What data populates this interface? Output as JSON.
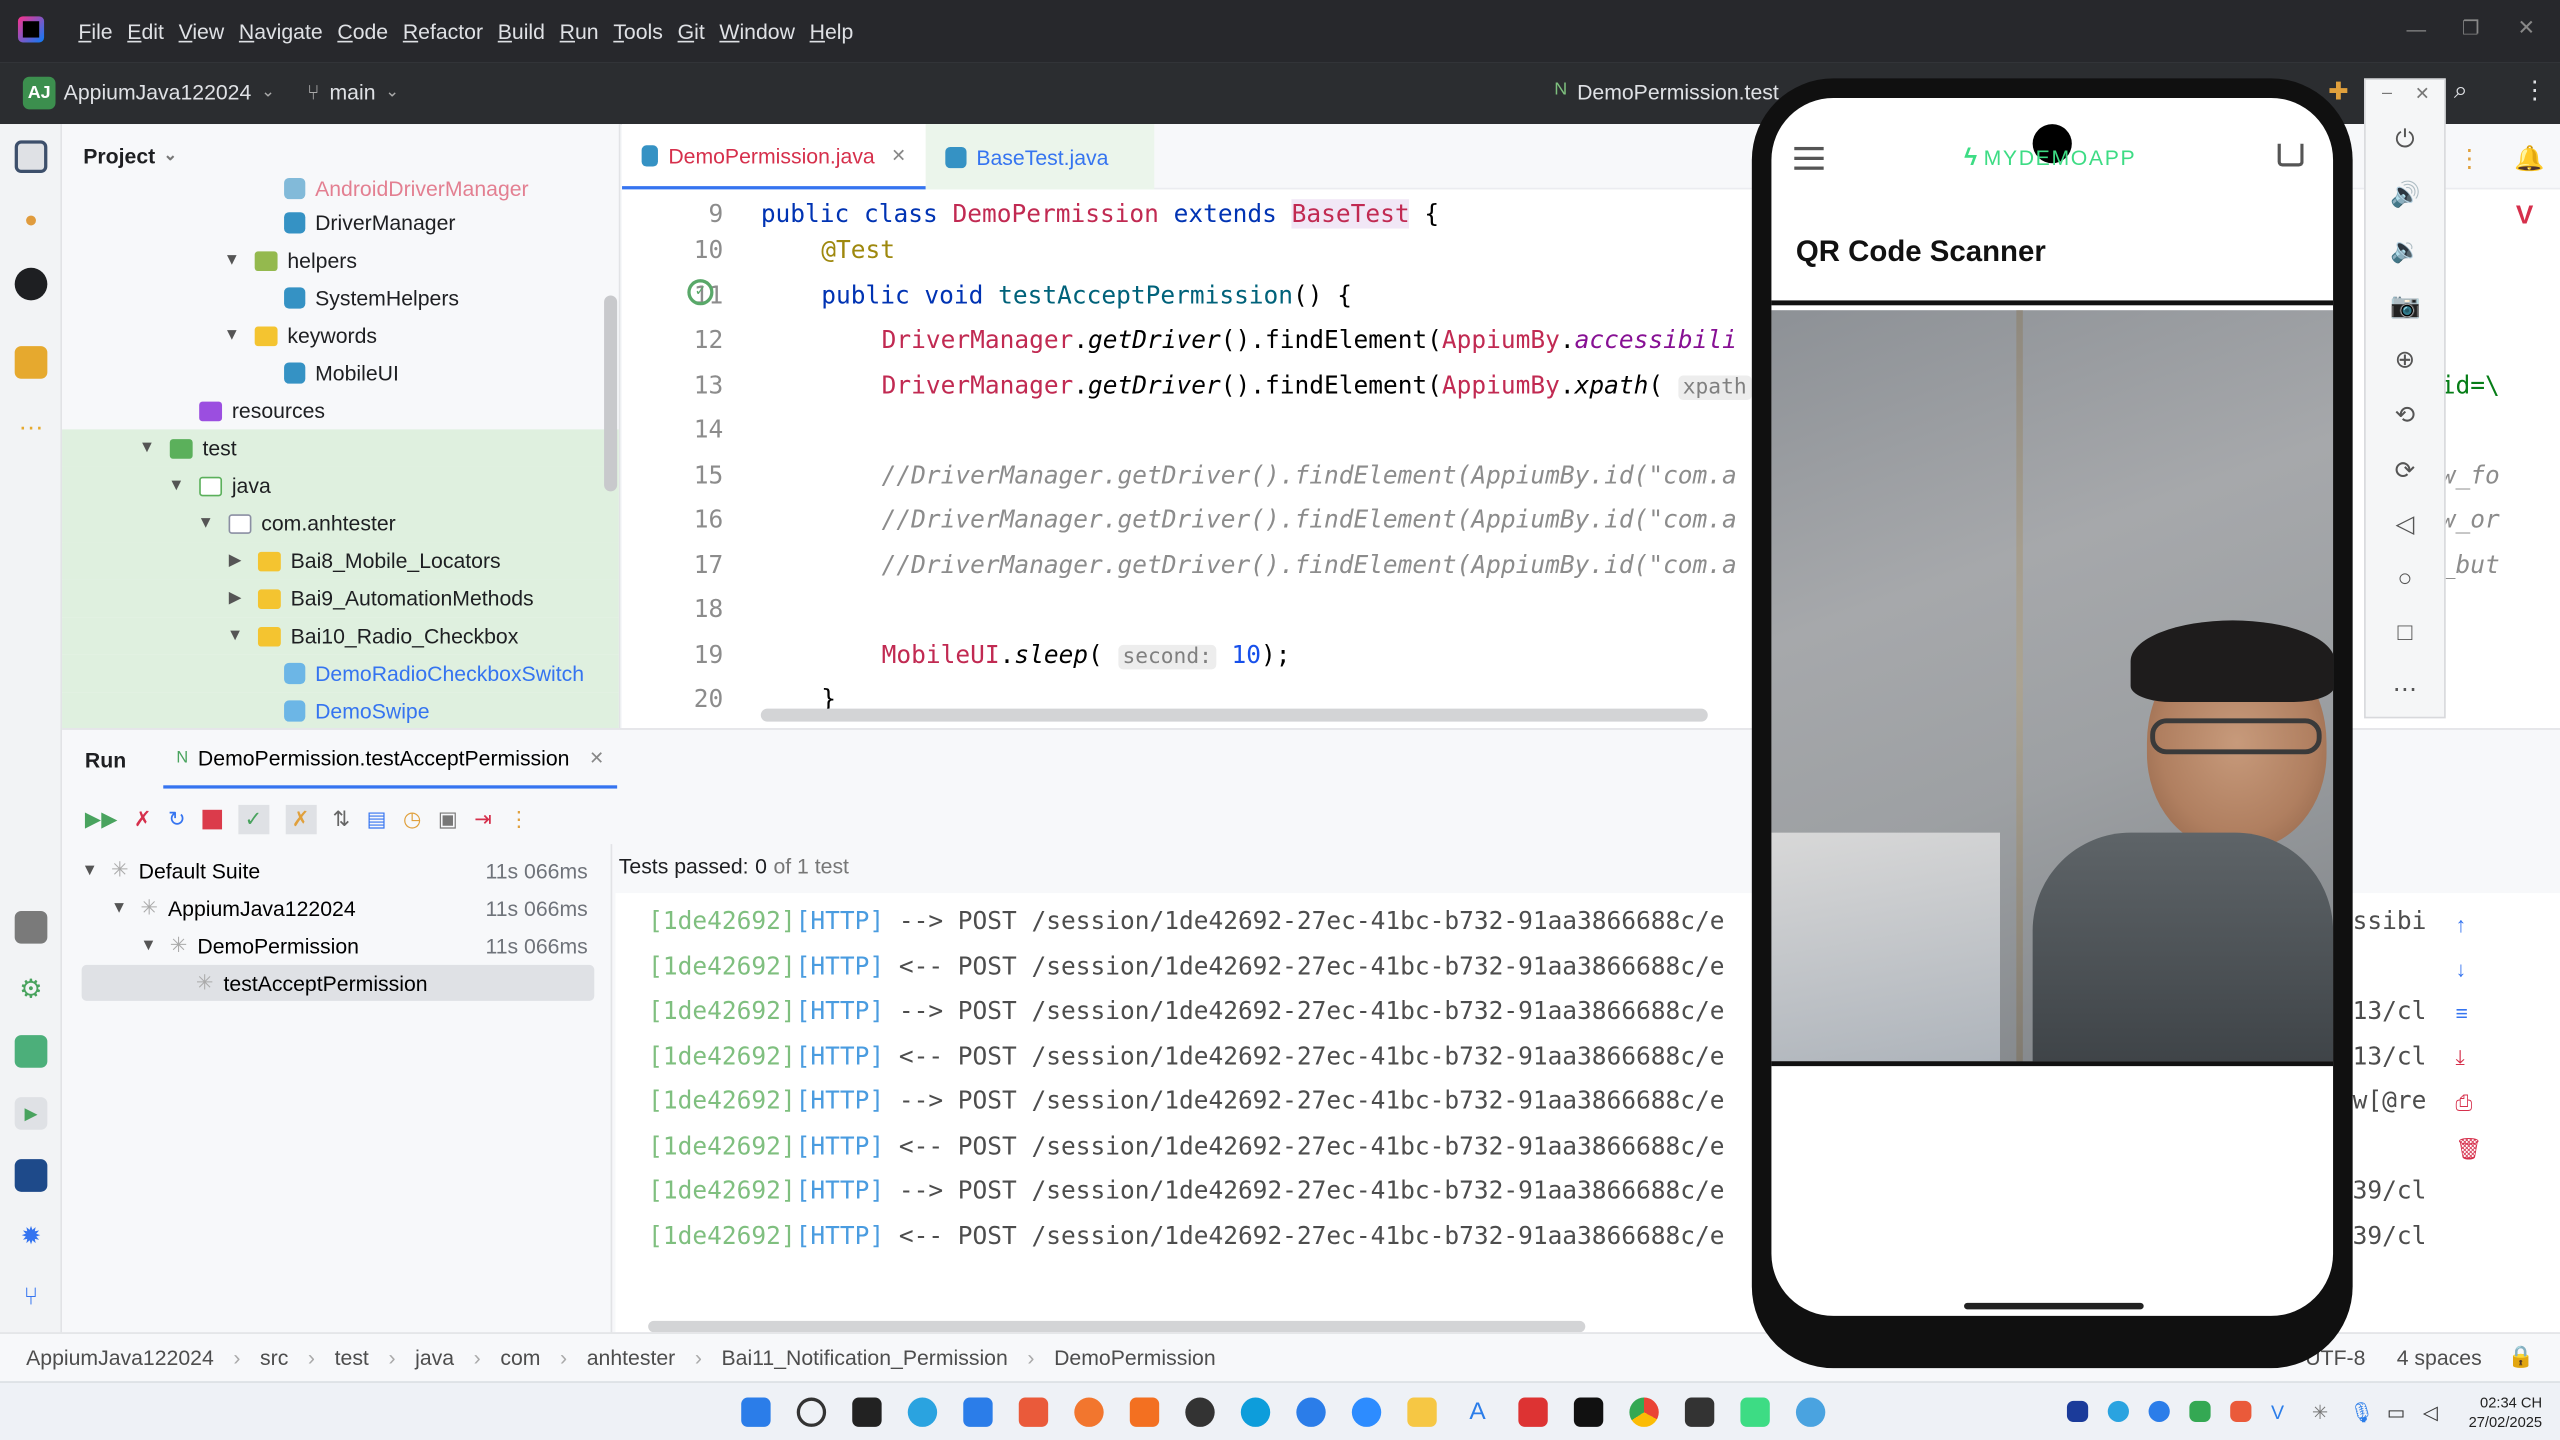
{
  "menu": [
    "File",
    "Edit",
    "View",
    "Navigate",
    "Code",
    "Refactor",
    "Build",
    "Run",
    "Tools",
    "Git",
    "Window",
    "Help"
  ],
  "toolbar": {
    "project_badge": "AJ",
    "project": "AppiumJava122024",
    "branch": "main",
    "run_config": "DemoPermission.test"
  },
  "project_panel": {
    "title": "Project"
  },
  "tree": [
    {
      "label": "AndroidDriverManager",
      "type": "java",
      "cut": true
    },
    {
      "label": "DriverManager",
      "type": "java"
    },
    {
      "label": "helpers",
      "type": "pkg-folder"
    },
    {
      "label": "SystemHelpers",
      "type": "java"
    },
    {
      "label": "keywords",
      "type": "pkg-folder"
    },
    {
      "label": "MobileUI",
      "type": "java"
    },
    {
      "label": "resources",
      "type": "res"
    },
    {
      "label": "test",
      "type": "folder"
    },
    {
      "label": "java",
      "type": "testsrc"
    },
    {
      "label": "com.anhtester",
      "type": "pkg"
    },
    {
      "label": "Bai8_Mobile_Locators",
      "type": "folder"
    },
    {
      "label": "Bai9_AutomationMethods",
      "type": "folder"
    },
    {
      "label": "Bai10_Radio_Checkbox",
      "type": "folder"
    },
    {
      "label": "DemoRadioCheckboxSwitch",
      "type": "java"
    },
    {
      "label": "DemoSwipe",
      "type": "java"
    }
  ],
  "editor_tabs": [
    {
      "label": "DemoPermission.java",
      "active": true
    },
    {
      "label": "BaseTest.java",
      "active": false
    }
  ],
  "code": {
    "line_numbers": [
      "9",
      "10",
      "11",
      "12",
      "13",
      "14",
      "15",
      "16",
      "17",
      "18",
      "19",
      "20"
    ],
    "l9": [
      "public class ",
      "DemoPermission",
      " extends ",
      "BaseTest",
      " {"
    ],
    "l10": "@Test",
    "l11": [
      "public void ",
      "testAcceptPermission",
      "() {"
    ],
    "l12": [
      "DriverManager",
      ".",
      "getDriver",
      "().findElement(",
      "AppiumBy",
      ".",
      "accessibili"
    ],
    "l13": [
      "DriverManager",
      ".",
      "getDriver",
      "().findElement(",
      "AppiumBy",
      ".",
      "xpath",
      "(",
      "xpath"
    ],
    "l15": "//DriverManager.getDriver().findElement(AppiumBy.id(\"com.a",
    "l16": "//DriverManager.getDriver().findElement(AppiumBy.id(\"com.a",
    "l17": "//DriverManager.getDriver().findElement(AppiumBy.id(\"com.a",
    "l19": [
      "MobileUI",
      ".",
      "sleep",
      "(",
      "second:",
      "10",
      ");"
    ],
    "l20": "}",
    "right_fragments": [
      "id=\\",
      "w_fo",
      "w_or",
      "_but"
    ]
  },
  "run": {
    "label": "Run",
    "tab": "DemoPermission.testAcceptPermission",
    "tests_passed_label": "Tests passed:",
    "tests_passed_value": "0",
    "tests_total": "of 1 test",
    "tree": [
      {
        "label": "Default Suite",
        "time": "11s 066ms"
      },
      {
        "label": "AppiumJava122024",
        "time": "11s 066ms"
      },
      {
        "label": "DemoPermission",
        "time": "11s 066ms"
      },
      {
        "label": "testAcceptPermission",
        "time": ""
      }
    ]
  },
  "console_lines": [
    {
      "id": "[1de42692]",
      "tag": "[HTTP]",
      "dir": "-->",
      "text": " POST /session/1de42692-27ec-41bc-b732-91aa3866688c/e",
      "tail": "ssibi"
    },
    {
      "id": "[1de42692]",
      "tag": "[HTTP]",
      "dir": "<--",
      "text": " POST /session/1de42692-27ec-41bc-b732-91aa3866688c/e",
      "tail": ""
    },
    {
      "id": "[1de42692]",
      "tag": "[HTTP]",
      "dir": "-->",
      "text": " POST /session/1de42692-27ec-41bc-b732-91aa3866688c/e",
      "tail": "13/cl"
    },
    {
      "id": "[1de42692]",
      "tag": "[HTTP]",
      "dir": "<--",
      "text": " POST /session/1de42692-27ec-41bc-b732-91aa3866688c/e",
      "tail": "13/cl"
    },
    {
      "id": "[1de42692]",
      "tag": "[HTTP]",
      "dir": "-->",
      "text": " POST /session/1de42692-27ec-41bc-b732-91aa3866688c/e",
      "tail": "w[@re"
    },
    {
      "id": "[1de42692]",
      "tag": "[HTTP]",
      "dir": "<--",
      "text": " POST /session/1de42692-27ec-41bc-b732-91aa3866688c/e",
      "tail": ""
    },
    {
      "id": "[1de42692]",
      "tag": "[HTTP]",
      "dir": "-->",
      "text": " POST /session/1de42692-27ec-41bc-b732-91aa3866688c/e",
      "tail": "39/cl"
    },
    {
      "id": "[1de42692]",
      "tag": "[HTTP]",
      "dir": "<--",
      "text": " POST /session/1de42692-27ec-41bc-b732-91aa3866688c/e",
      "tail": "39/cl"
    }
  ],
  "breadcrumb": [
    "AppiumJava122024",
    "src",
    "test",
    "java",
    "com",
    "anhtester",
    "Bai11_Notification_Permission",
    "DemoPermission"
  ],
  "status": {
    "encoding": "UTF-8",
    "indent": "4 spaces"
  },
  "phone": {
    "app_name": "MYDEMOAPP",
    "screen_title": "QR Code Scanner"
  },
  "clock": {
    "time": "02:34 CH",
    "date": "27/02/2025"
  },
  "colors": {
    "accent": "#3574f0",
    "green": "#59a869",
    "logo_green": "#3ddc84"
  }
}
